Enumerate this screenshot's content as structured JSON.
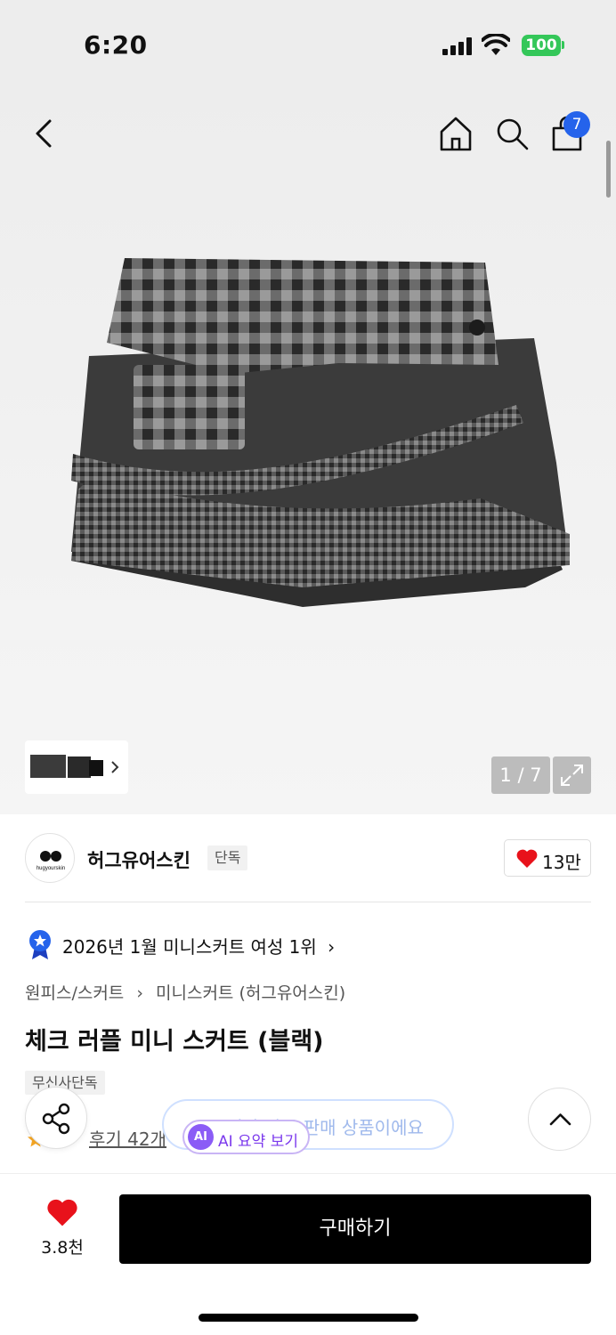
{
  "status": {
    "time": "6:20",
    "battery": "100"
  },
  "nav": {
    "cart_count": "7"
  },
  "gallery": {
    "counter": "1 / 7",
    "thumbs_more": "›"
  },
  "brand": {
    "name": "허그유어스킨",
    "tag": "단독",
    "likes": "13만",
    "logo_text": "hugyourskin"
  },
  "ranking": {
    "text": "2026년 1월 미니스커트 여성 1위",
    "arrow": "›"
  },
  "breadcrumb": {
    "category": "원피스/스커트",
    "sep": "›",
    "sub": "미니스커트 (허그유어스킨)"
  },
  "product": {
    "title": "체크 러플 미니 스커트 (블랙)",
    "exclusive_tag": "무신사단독"
  },
  "reviews": {
    "label": "후기 42개"
  },
  "overlay": {
    "exclusive_notice": "무신사 단독 판매 상품이에요",
    "ai_icon": "AI",
    "ai_label": "AI 요약 보기"
  },
  "bottom": {
    "fav_count": "3.8천",
    "buy_label": "구매하기"
  },
  "colors": {
    "accent_blue": "#2563eb",
    "heart_red": "#e8121b",
    "battery_green": "#34c759",
    "ai_purple": "#7c3aed"
  }
}
